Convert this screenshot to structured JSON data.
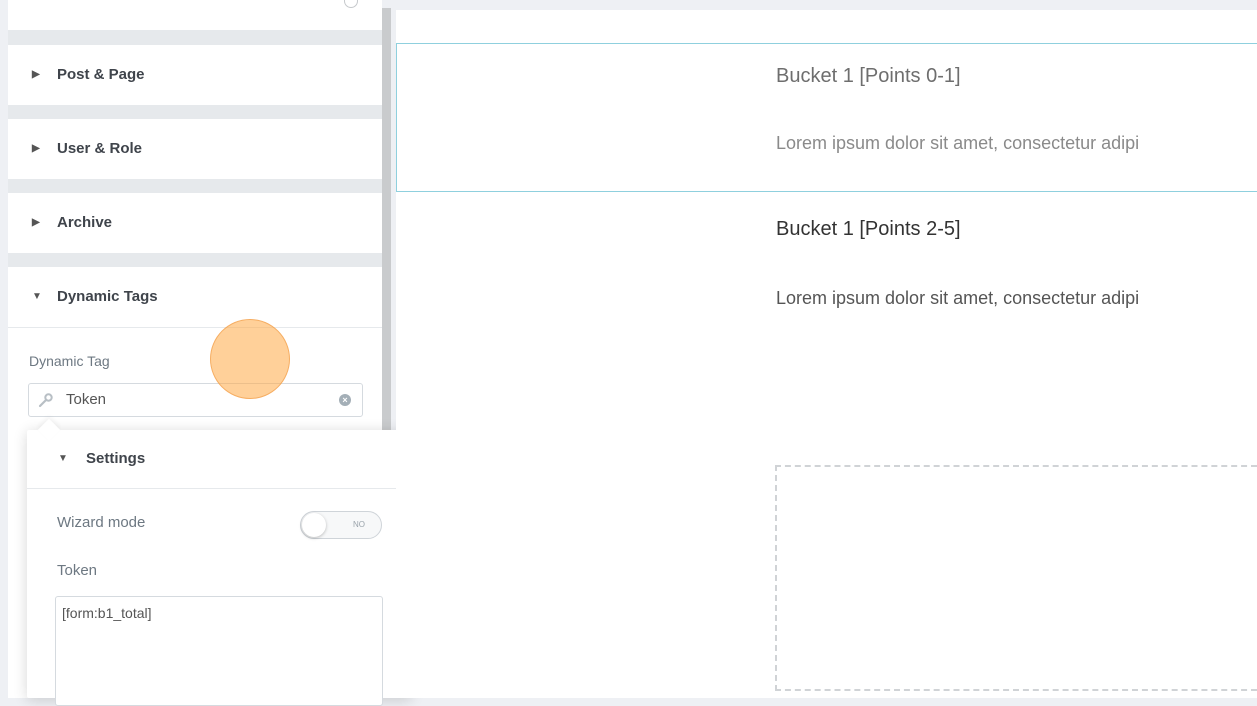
{
  "sidebar": {
    "sections": [
      {
        "label": "Post & Page",
        "expanded": false
      },
      {
        "label": "User & Role",
        "expanded": false
      },
      {
        "label": "Archive",
        "expanded": false
      },
      {
        "label": "Dynamic Tags",
        "expanded": true
      }
    ],
    "dynamic_tag": {
      "field_label": "Dynamic Tag",
      "value": "Token"
    }
  },
  "settings_popover": {
    "title": "Settings",
    "wizard_mode_label": "Wizard mode",
    "wizard_mode_toggle_text": "NO",
    "wizard_mode_on": false,
    "token_label": "Token",
    "token_value": "[form:b1_total]"
  },
  "canvas": {
    "buckets": [
      {
        "title": "Bucket 1 [Points 0-1]",
        "text": "Lorem ipsum dolor sit amet, consectetur adipi"
      },
      {
        "title": "Bucket 1 [Points 2-5]",
        "text": "Lorem ipsum dolor sit amet, consectetur adipi"
      }
    ]
  },
  "colors": {
    "sidebar_bg": "#e6e9ec",
    "selected_border": "#8fd0de",
    "cursor_highlight": "#ffaa46"
  }
}
